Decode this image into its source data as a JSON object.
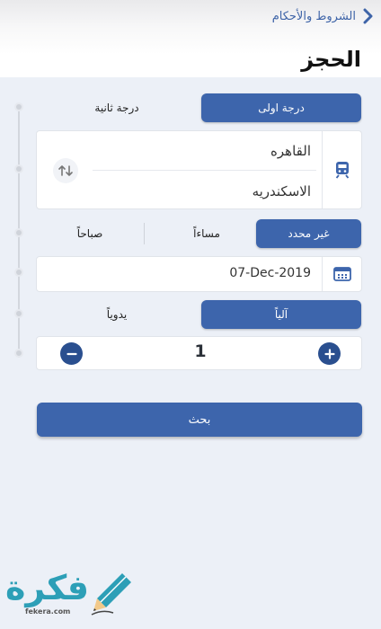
{
  "header": {
    "back_label": "الشروط والأحكام",
    "title": "الحجز"
  },
  "class_selector": {
    "first_class": "درجة اولى",
    "second_class": "درجة ثانية",
    "selected": "first_class"
  },
  "route": {
    "from": "القاهره",
    "to": "الاسكندريه"
  },
  "time_selector": {
    "unspecified": "غير محدد",
    "evening": "مساءاً",
    "morning": "صباحاً",
    "selected": "unspecified"
  },
  "date": {
    "value": "07-Dec-2019"
  },
  "mode_selector": {
    "auto": "آلياً",
    "manual": "يدوياً",
    "selected": "auto"
  },
  "quantity": {
    "value": "1"
  },
  "search_button": {
    "label": "بحث"
  },
  "watermark": {
    "brand": "فكرة",
    "site": "fekera.com"
  },
  "colors": {
    "accent": "#3d65ac",
    "background": "#ecf0f7",
    "dark_button": "#2a4f8f",
    "watermark": "#2d9fb7"
  },
  "icons": [
    "chevron-right-icon",
    "train-icon",
    "swap-icon",
    "calendar-icon",
    "minus-icon",
    "plus-icon",
    "pencil-icon"
  ]
}
